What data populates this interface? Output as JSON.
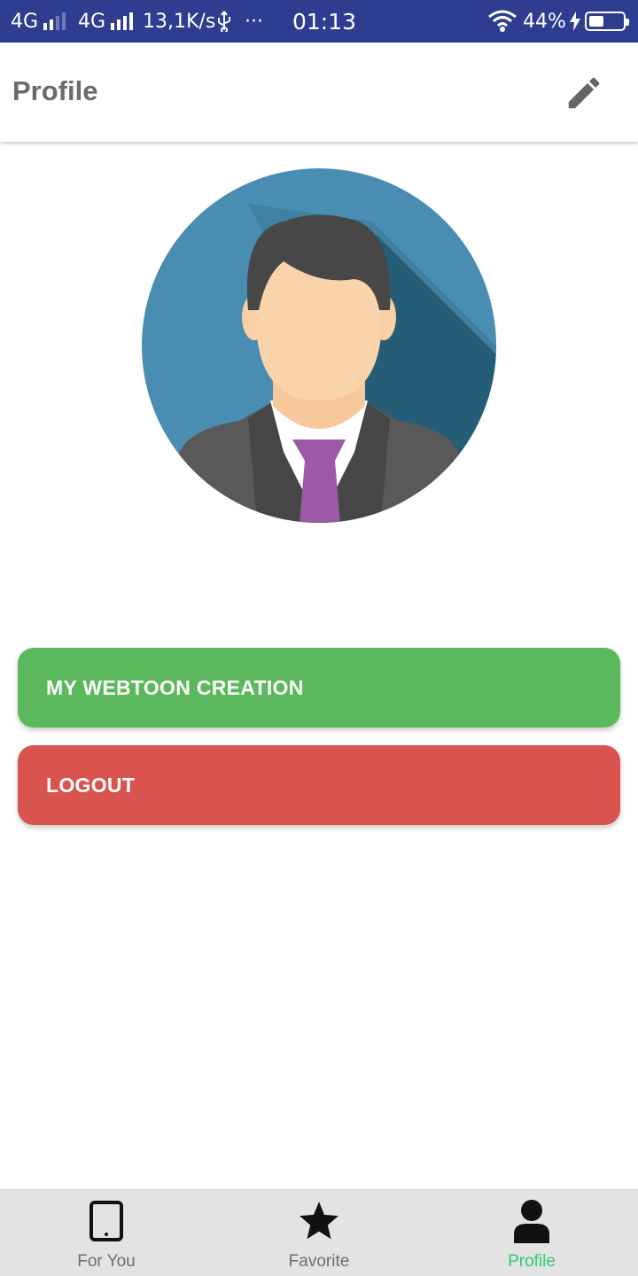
{
  "status_bar": {
    "network_1": "4G",
    "network_2": "4G",
    "speed": "13,1K/s",
    "usb_icon": "usb-icon",
    "more": "···",
    "time": "01:13",
    "battery_percent": "44%",
    "battery_level": 0.44,
    "charging": true
  },
  "app_bar": {
    "title": "Profile",
    "edit_icon": "pencil-icon"
  },
  "avatar": {
    "icon": "businessman-avatar",
    "background_color": "#4a8db3"
  },
  "actions": {
    "webtoon_label": "MY WEBTOON CREATION",
    "logout_label": "LOGOUT"
  },
  "bottom_nav": {
    "items": [
      {
        "label": "For You",
        "icon": "tablet-icon",
        "active": false
      },
      {
        "label": "Favorite",
        "icon": "star-icon",
        "active": false
      },
      {
        "label": "Profile",
        "icon": "person-icon",
        "active": true
      }
    ]
  },
  "colors": {
    "status_bar": "#2e3d8f",
    "button_green": "#5cb85c",
    "button_red": "#d9534f",
    "nav_active": "#2ecc71",
    "nav_background": "#e3e3e3"
  }
}
